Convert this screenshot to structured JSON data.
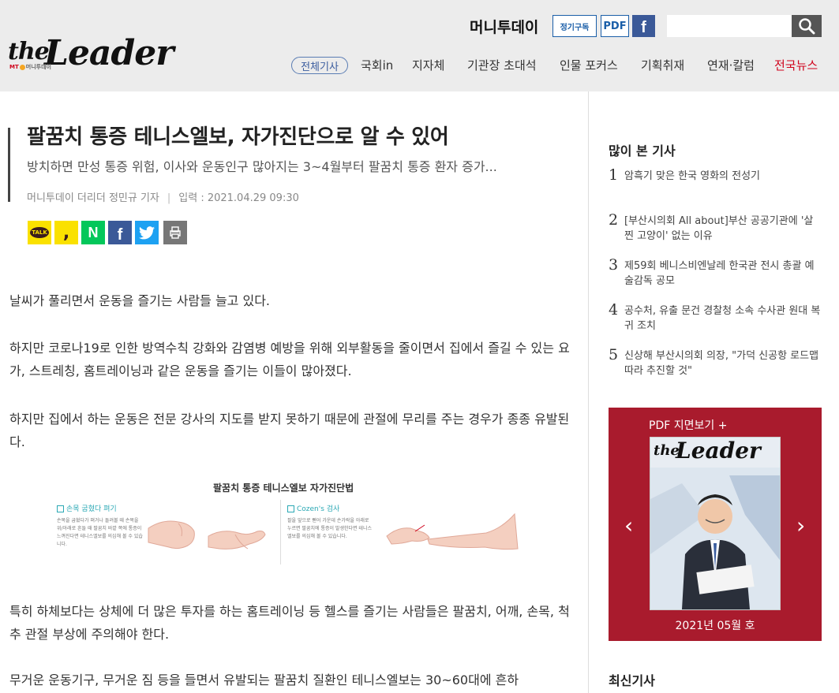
{
  "header": {
    "logo": {
      "the": "the",
      "leader": "Leader",
      "mt_prefix": "MT",
      "mt_name": "머니투데이"
    },
    "brand": "머니투데이",
    "subscribe_label": "정기구독",
    "pdf_label": "PDF",
    "facebook_icon": "facebook-icon",
    "search": {
      "value": "",
      "placeholder": ""
    },
    "nav": {
      "all": "전체기사",
      "items": [
        "국회in",
        "지자체",
        "기관장 초대석",
        "인물 포커스",
        "기획취재",
        "연재·칼럼",
        "전국뉴스"
      ]
    }
  },
  "article": {
    "title": "팔꿈치 통증 테니스엘보, 자가진단으로 알 수 있어",
    "subtitle": "방치하면 만성 통증 위험, 이사와 운동인구 많아지는 3~4월부터 팔꿈치 통증 환자 증가...",
    "byline": {
      "author": "머니투데이 더리더 정민규 기자",
      "date": "입력 : 2021.04.29 09:30"
    },
    "share": [
      "kakaotalk",
      "kakaostory",
      "naver",
      "facebook",
      "twitter",
      "print"
    ],
    "paragraphs": [
      "날씨가 풀리면서 운동을 즐기는 사람들 늘고 있다.",
      "하지만 코로나19로 인한 방역수칙 강화와 감염병 예방을 위해 외부활동을 줄이면서 집에서 즐길 수 있는 요가, 스트레칭, 홈트레이닝과 같은 운동을 즐기는 이들이 많아졌다.",
      "하지만 집에서 하는 운동은 전문 강사의 지도를 받지 못하기 때문에 관절에 무리를 주는 경우가 종종 유발된다.",
      "특히 하체보다는 상체에 더 많은 투자를 하는 홈트레이닝 등 헬스를 즐기는 사람들은 팔꿈치, 어깨, 손목, 척추 관절 부상에 주의해야 한다.",
      "무거운 운동기구, 무거운 짐 등을 들면서 유발되는 팔꿈치 질환인 테니스엘보는 30~60대에 흔하"
    ],
    "figure": {
      "title": "팔꿈치 통증 테니스엘보 자가진단법",
      "left_label": "손목 굽혔다 펴기",
      "left_desc": "손목을 굽혔다가 펴거나 돌려볼 때 손목을 위/아래로 흔들 때 팔꿈치 바깥 쪽에 통증이 느껴진다면 테니스엘보를 의심해 볼 수 있습니다.",
      "right_label": "Cozen's 검사",
      "right_desc": "팔을 앞으로 뻗어 가운데 손가락을 아래로 누르면 팔꿈치에 통증이 발생한다면 테니스엘보를 의심해 볼 수 있습니다."
    }
  },
  "sidebar": {
    "popular_title": "많이 본 기사",
    "popular": [
      {
        "num": "1",
        "text": "암흑기 맞은 한국 영화의 전성기"
      },
      {
        "num": "2",
        "text": "[부산시의회 All about]부산 공공기관에 '살찐 고양이' 없는 이유"
      },
      {
        "num": "3",
        "text": "제59회 베니스비엔날레 한국관 전시 총괄 예술감독 공모"
      },
      {
        "num": "4",
        "text": "공수처, 유출 문건 경찰청 소속 수사관 원대 복귀 조치"
      },
      {
        "num": "5",
        "text": "신상해 부산시의회 의장, \"가덕 신공항 로드맵 따라 추진할 것\""
      }
    ],
    "pdf": {
      "title": "PDF 지면보기 +",
      "cover_the": "the",
      "cover_leader": "Leader",
      "date": "2021년 05월 호",
      "prev": "‹",
      "next": "›"
    },
    "latest_title": "최신기사"
  }
}
